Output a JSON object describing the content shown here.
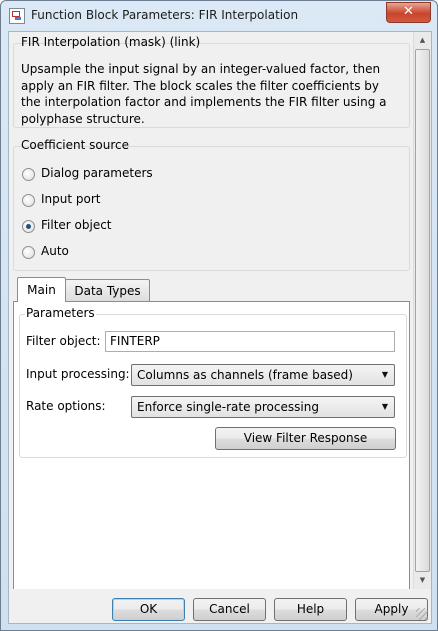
{
  "window": {
    "title": "Function Block Parameters: FIR Interpolation",
    "close_glyph": "✕"
  },
  "mask": {
    "header": "FIR Interpolation (mask) (link)",
    "description": "Upsample the input signal by an integer-valued factor, then apply an FIR filter. The block scales the filter coefficients by the interpolation factor and implements the FIR filter using a polyphase structure."
  },
  "coefficient_source": {
    "label": "Coefficient source",
    "options": [
      {
        "label": "Dialog parameters",
        "selected": false
      },
      {
        "label": "Input port",
        "selected": false
      },
      {
        "label": "Filter object",
        "selected": true
      },
      {
        "label": "Auto",
        "selected": false
      }
    ]
  },
  "tabs": [
    {
      "label": "Main",
      "active": true
    },
    {
      "label": "Data Types",
      "active": false
    }
  ],
  "parameters": {
    "label": "Parameters",
    "filter_object": {
      "label": "Filter object:",
      "value": "FINTERP"
    },
    "input_processing": {
      "label": "Input processing:",
      "value": "Columns as channels (frame based)"
    },
    "rate_options": {
      "label": "Rate options:",
      "value": "Enforce single-rate processing"
    },
    "view_response_button": "View Filter Response"
  },
  "buttons": {
    "ok": "OK",
    "cancel": "Cancel",
    "help": "Help",
    "apply": "Apply"
  },
  "icons": {
    "app": "simulink-block-icon",
    "close": "close-icon",
    "dropdown": "chevron-down-icon",
    "scroll_up": "scroll-up-arrow-icon",
    "scroll_down": "scroll-down-arrow-icon",
    "resize": "resize-grip-icon"
  },
  "colors": {
    "close_button": "#c8452d",
    "default_button_border": "#3c7fb1",
    "dialog_bg": "#f0f0f0",
    "titlebar": "#dbe8f5"
  }
}
